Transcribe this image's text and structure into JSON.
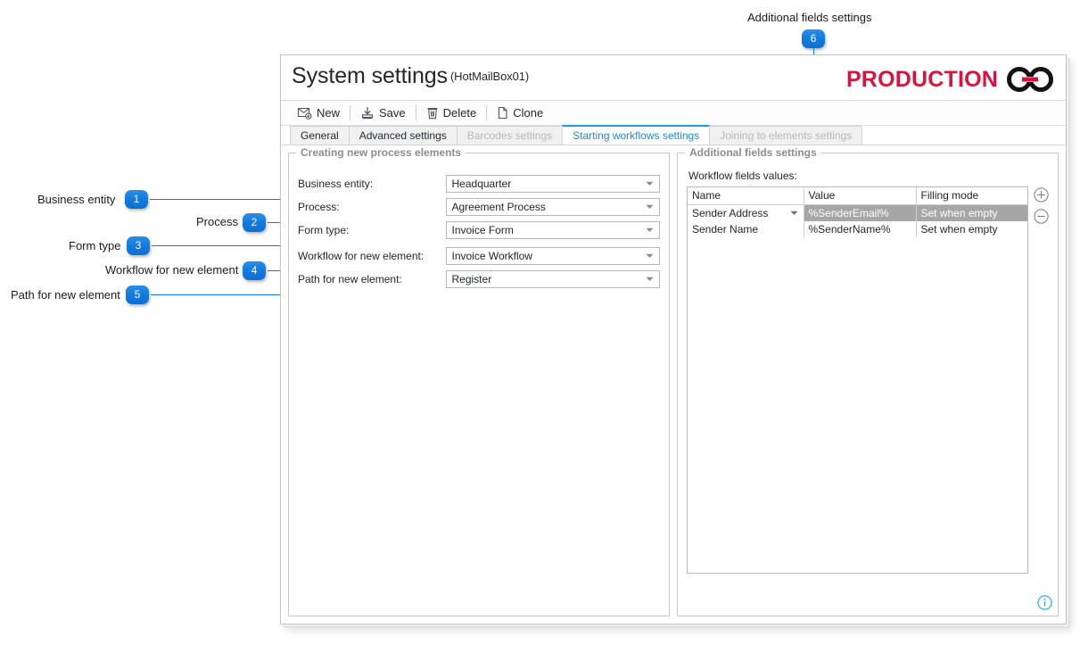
{
  "annotations": [
    {
      "n": "1",
      "label": "Business entity"
    },
    {
      "n": "2",
      "label": "Process"
    },
    {
      "n": "3",
      "label": "Form type"
    },
    {
      "n": "4",
      "label": "Workflow for new element"
    },
    {
      "n": "5",
      "label": "Path for new element"
    },
    {
      "n": "6",
      "label": "Additional fields settings"
    }
  ],
  "window": {
    "title": "System settings",
    "title_sub": "(HotMailBox01)",
    "brand_text": "PRODUCTION",
    "brand_accent": "#d8143c"
  },
  "toolbar": {
    "items": [
      {
        "label": "New",
        "icon": "new-mail-icon"
      },
      {
        "label": "Save",
        "icon": "save-icon"
      },
      {
        "label": "Delete",
        "icon": "trash-icon"
      },
      {
        "label": "Clone",
        "icon": "copy-page-icon"
      }
    ]
  },
  "tabs": [
    {
      "label": "General",
      "state": "normal"
    },
    {
      "label": "Advanced settings",
      "state": "normal"
    },
    {
      "label": "Barcodes settings",
      "state": "disabled"
    },
    {
      "label": "Starting workflows settings",
      "state": "active"
    },
    {
      "label": "Joining to elements settings",
      "state": "disabled"
    }
  ],
  "left_panel": {
    "title": "Creating new process elements",
    "fields": [
      {
        "label": "Business entity:",
        "value": "Headquarter"
      },
      {
        "label": "Process:",
        "value": "Agreement Process"
      },
      {
        "label": "Form type:",
        "value": "Invoice Form"
      },
      {
        "label": "Workflow for new element:",
        "value": "Invoice Workflow"
      },
      {
        "label": "Path for new element:",
        "value": "Register"
      }
    ]
  },
  "right_panel": {
    "title": "Additional fields settings",
    "sub_label": "Workflow fields values:",
    "grid": {
      "columns": [
        "Name",
        "Value",
        "Filling mode"
      ],
      "rows": [
        {
          "name": "Sender Address",
          "value": "%SenderEmail%",
          "mode": "Set when empty",
          "selected": true,
          "has_caret": true
        },
        {
          "name": "Sender Name",
          "value": "%SenderName%",
          "mode": "Set when empty",
          "selected": false,
          "has_caret": false
        }
      ]
    },
    "add_button_label": "+",
    "remove_button_label": "−",
    "info_button_label": "i"
  },
  "colors": {
    "badge": "#1179dd",
    "active_tab_text": "#1e88d6",
    "selection": "#a6a6a6",
    "info": "#24a8ef"
  }
}
